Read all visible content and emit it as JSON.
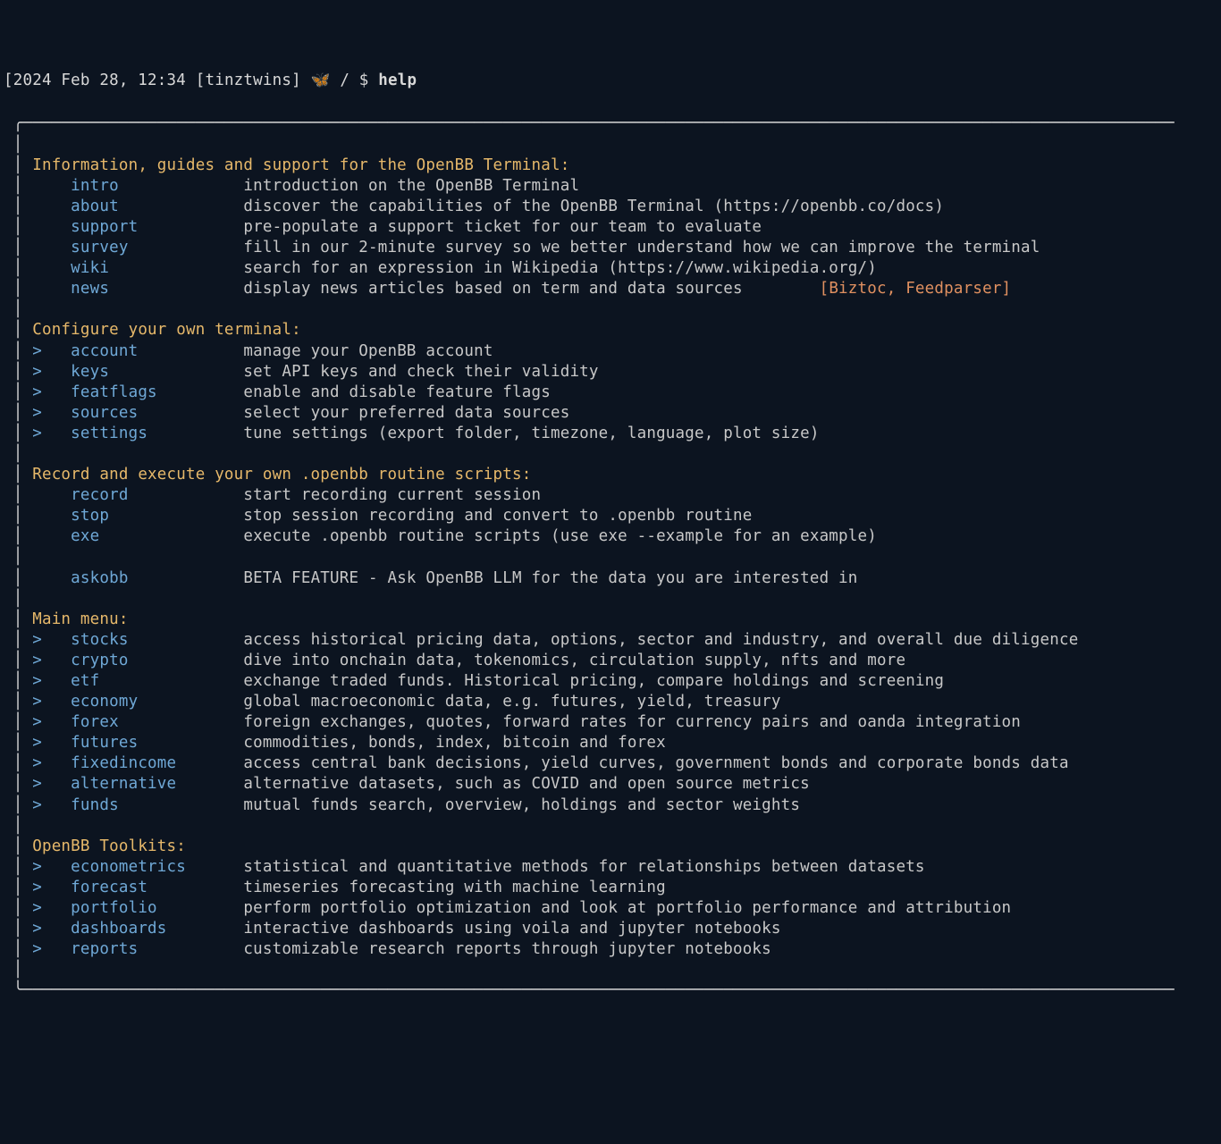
{
  "prompt": {
    "timestamp": "2024 Feb 28, 12:34",
    "user": "tinztwins",
    "emoji": "🦋",
    "path": "/",
    "symbol": "$",
    "command": "help"
  },
  "box": {
    "tl": "╭",
    "bl": "╰",
    "v": "│",
    "h": "─"
  },
  "sections": [
    {
      "title": "Information, guides and support for the OpenBB Terminal:",
      "items": [
        {
          "chev": false,
          "cmd": "intro",
          "desc": "introduction on the OpenBB Terminal"
        },
        {
          "chev": false,
          "cmd": "about",
          "desc": "discover the capabilities of the OpenBB Terminal (https://openbb.co/docs)"
        },
        {
          "chev": false,
          "cmd": "support",
          "desc": "pre-populate a support ticket for our team to evaluate"
        },
        {
          "chev": false,
          "cmd": "survey",
          "desc": "fill in our 2-minute survey so we better understand how we can improve the terminal"
        },
        {
          "chev": false,
          "cmd": "wiki",
          "desc": "search for an expression in Wikipedia (https://www.wikipedia.org/)"
        },
        {
          "chev": false,
          "cmd": "news",
          "desc": "display news articles based on term and data sources",
          "tag": "[Biztoc, Feedparser]"
        }
      ]
    },
    {
      "title": "Configure your own terminal:",
      "items": [
        {
          "chev": true,
          "cmd": "account",
          "desc": "manage your OpenBB account"
        },
        {
          "chev": true,
          "cmd": "keys",
          "desc": "set API keys and check their validity"
        },
        {
          "chev": true,
          "cmd": "featflags",
          "desc": "enable and disable feature flags"
        },
        {
          "chev": true,
          "cmd": "sources",
          "desc": "select your preferred data sources"
        },
        {
          "chev": true,
          "cmd": "settings",
          "desc": "tune settings (export folder, timezone, language, plot size)"
        }
      ]
    },
    {
      "title": "Record and execute your own .openbb routine scripts:",
      "items": [
        {
          "chev": false,
          "cmd": "record",
          "desc": "start recording current session"
        },
        {
          "chev": false,
          "cmd": "stop",
          "desc": "stop session recording and convert to .openbb routine"
        },
        {
          "chev": false,
          "cmd": "exe",
          "desc": "execute .openbb routine scripts (use exe --example for an example)"
        },
        {
          "blank": true
        },
        {
          "chev": false,
          "cmd": "askobb",
          "desc": "BETA FEATURE - Ask OpenBB LLM for the data you are interested in"
        }
      ]
    },
    {
      "title": "Main menu:",
      "items": [
        {
          "chev": true,
          "cmd": "stocks",
          "desc": "access historical pricing data, options, sector and industry, and overall due diligence"
        },
        {
          "chev": true,
          "cmd": "crypto",
          "desc": "dive into onchain data, tokenomics, circulation supply, nfts and more"
        },
        {
          "chev": true,
          "cmd": "etf",
          "desc": "exchange traded funds. Historical pricing, compare holdings and screening"
        },
        {
          "chev": true,
          "cmd": "economy",
          "desc": "global macroeconomic data, e.g. futures, yield, treasury"
        },
        {
          "chev": true,
          "cmd": "forex",
          "desc": "foreign exchanges, quotes, forward rates for currency pairs and oanda integration"
        },
        {
          "chev": true,
          "cmd": "futures",
          "desc": "commodities, bonds, index, bitcoin and forex"
        },
        {
          "chev": true,
          "cmd": "fixedincome",
          "desc": "access central bank decisions, yield curves, government bonds and corporate bonds data"
        },
        {
          "chev": true,
          "cmd": "alternative",
          "desc": "alternative datasets, such as COVID and open source metrics"
        },
        {
          "chev": true,
          "cmd": "funds",
          "desc": "mutual funds search, overview, holdings and sector weights"
        }
      ]
    },
    {
      "title": "OpenBB Toolkits:",
      "items": [
        {
          "chev": true,
          "cmd": "econometrics",
          "desc": "statistical and quantitative methods for relationships between datasets"
        },
        {
          "chev": true,
          "cmd": "forecast",
          "desc": "timeseries forecasting with machine learning"
        },
        {
          "chev": true,
          "cmd": "portfolio",
          "desc": "perform portfolio optimization and look at portfolio performance and attribution"
        },
        {
          "chev": true,
          "cmd": "dashboards",
          "desc": "interactive dashboards using voila and jupyter notebooks"
        },
        {
          "chev": true,
          "cmd": "reports",
          "desc": "customizable research reports through jupyter notebooks"
        }
      ]
    }
  ]
}
